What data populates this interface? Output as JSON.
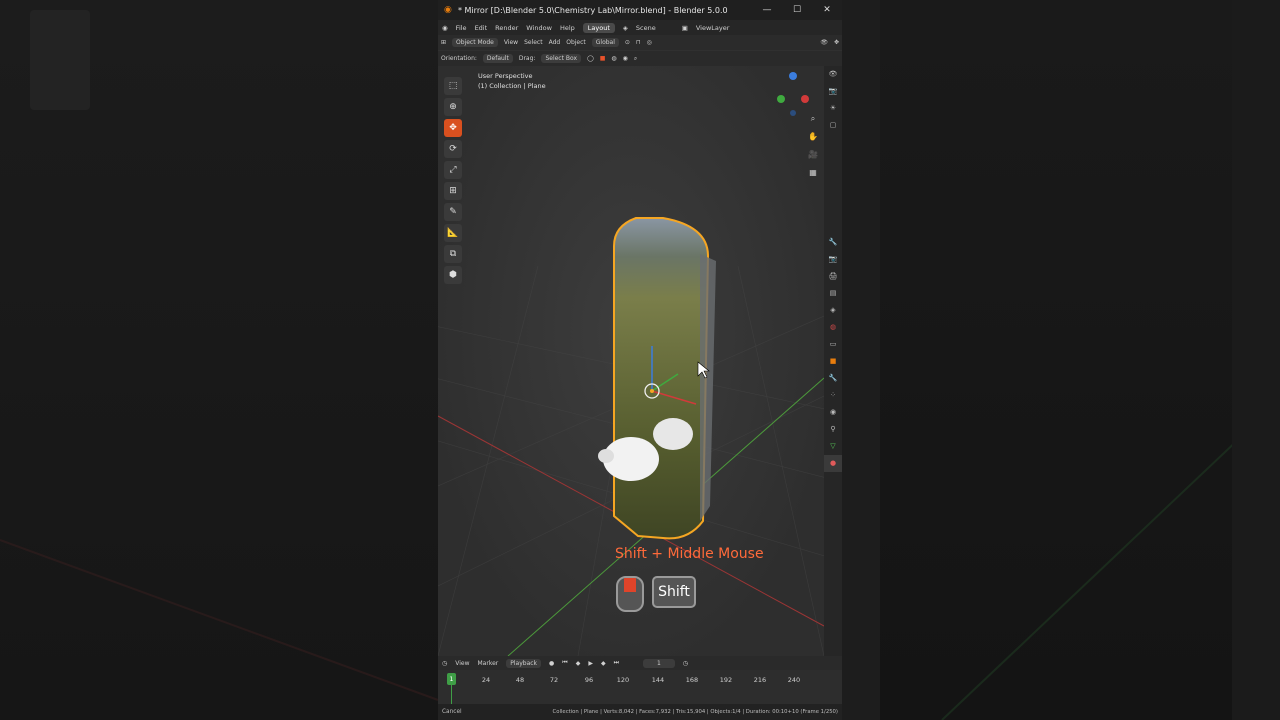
{
  "window": {
    "title": "* Mirror [D:\\Blender 5.0\\Chemistry Lab\\Mirror.blend] - Blender 5.0.0",
    "minimize_icon": "minimize-icon",
    "maximize_icon": "maximize-icon",
    "close_icon": "close-icon"
  },
  "menubar": {
    "items": [
      "File",
      "Edit",
      "Render",
      "Window",
      "Help"
    ],
    "workspace_tab": "Layout",
    "scene_label": "Scene",
    "viewlayer_label": "ViewLayer"
  },
  "header": {
    "mode": "Object Mode",
    "menus": [
      "View",
      "Select",
      "Add",
      "Object"
    ],
    "transform_orientation": "Global"
  },
  "tool_settings": {
    "orientation_label": "Orientation:",
    "orientation_value": "Default",
    "drag_label": "Drag:",
    "drag_value": "Select Box"
  },
  "viewport": {
    "view_name": "User Perspective",
    "collection_info": "(1) Collection | Plane",
    "overlay_hint": "Shift + Middle Mouse",
    "key_label": "Shift"
  },
  "timeline": {
    "menus": [
      "View",
      "Marker",
      "Playback"
    ],
    "current_frame": "1",
    "frame_field": "1",
    "ticks": [
      "24",
      "48",
      "72",
      "96",
      "120",
      "144",
      "168",
      "192",
      "216",
      "240"
    ]
  },
  "statusbar": {
    "cancel": "Cancel",
    "stats": "Collection | Plane | Verts:8,042 | Faces:7,932 | Tris:15,904 | Objects:1/4 | Duration: 00:10+10 (Frame 1/250)"
  },
  "colors": {
    "accent": "#e87d0d",
    "active_tool": "#d9501f",
    "selection_outline": "#f5a623",
    "hint_text": "#ff6a3a",
    "frame_marker": "#3f9e46"
  }
}
